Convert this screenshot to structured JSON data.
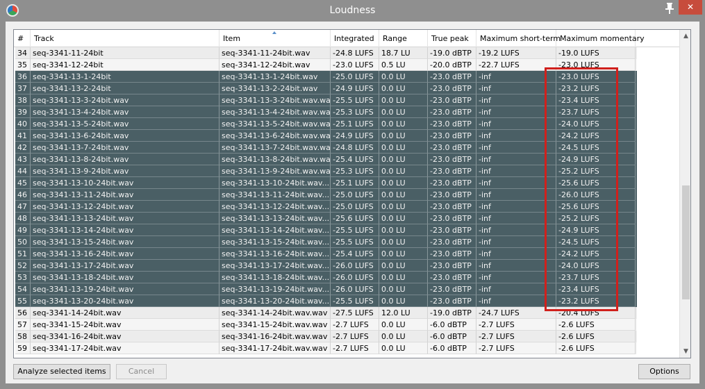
{
  "window": {
    "title": "Loudness",
    "close_label": "✕"
  },
  "table": {
    "columns": [
      "#",
      "Track",
      "Item",
      "Integrated",
      "Range",
      "True peak",
      "Maximum short-term",
      "Maximum momentary"
    ],
    "sort_column": "Item",
    "rows": [
      {
        "num": "34",
        "track": "seq-3341-11-24bit",
        "item": "seq-3341-11-24bit.wav",
        "integrated": "-24.8 LUFS",
        "range": "18.7 LU",
        "truepeak": "-19.0 dBTP",
        "shortterm": "-19.2 LUFS",
        "momentary": "-19.0 LUFS",
        "selected": false
      },
      {
        "num": "35",
        "track": "seq-3341-12-24bit",
        "item": "seq-3341-12-24bit.wav",
        "integrated": "-23.0 LUFS",
        "range": "0.5 LU",
        "truepeak": "-20.0 dBTP",
        "shortterm": "-22.7 LUFS",
        "momentary": "-23.0 LUFS",
        "selected": false
      },
      {
        "num": "36",
        "track": "seq-3341-13-1-24bit",
        "item": "seq-3341-13-1-24bit.wav",
        "integrated": "-25.0 LUFS",
        "range": "0.0 LU",
        "truepeak": "-23.0 dBTP",
        "shortterm": "-inf",
        "momentary": "-23.0 LUFS",
        "selected": true
      },
      {
        "num": "37",
        "track": "seq-3341-13-2-24bit",
        "item": "seq-3341-13-2-24bit.wav",
        "integrated": "-24.9 LUFS",
        "range": "0.0 LU",
        "truepeak": "-23.0 dBTP",
        "shortterm": "-inf",
        "momentary": "-23.2 LUFS",
        "selected": true
      },
      {
        "num": "38",
        "track": "seq-3341-13-3-24bit.wav",
        "item": "seq-3341-13-3-24bit.wav.wav",
        "integrated": "-25.5 LUFS",
        "range": "0.0 LU",
        "truepeak": "-23.0 dBTP",
        "shortterm": "-inf",
        "momentary": "-23.4 LUFS",
        "selected": true
      },
      {
        "num": "39",
        "track": "seq-3341-13-4-24bit.wav",
        "item": "seq-3341-13-4-24bit.wav.wav",
        "integrated": "-25.3 LUFS",
        "range": "0.0 LU",
        "truepeak": "-23.0 dBTP",
        "shortterm": "-inf",
        "momentary": "-23.7 LUFS",
        "selected": true
      },
      {
        "num": "40",
        "track": "seq-3341-13-5-24bit.wav",
        "item": "seq-3341-13-5-24bit.wav.wav",
        "integrated": "-25.1 LUFS",
        "range": "0.0 LU",
        "truepeak": "-23.0 dBTP",
        "shortterm": "-inf",
        "momentary": "-24.0 LUFS",
        "selected": true
      },
      {
        "num": "41",
        "track": "seq-3341-13-6-24bit.wav",
        "item": "seq-3341-13-6-24bit.wav.wav",
        "integrated": "-24.9 LUFS",
        "range": "0.0 LU",
        "truepeak": "-23.0 dBTP",
        "shortterm": "-inf",
        "momentary": "-24.2 LUFS",
        "selected": true
      },
      {
        "num": "42",
        "track": "seq-3341-13-7-24bit.wav",
        "item": "seq-3341-13-7-24bit.wav.wav",
        "integrated": "-24.8 LUFS",
        "range": "0.0 LU",
        "truepeak": "-23.0 dBTP",
        "shortterm": "-inf",
        "momentary": "-24.5 LUFS",
        "selected": true
      },
      {
        "num": "43",
        "track": "seq-3341-13-8-24bit.wav",
        "item": "seq-3341-13-8-24bit.wav.wav",
        "integrated": "-25.4 LUFS",
        "range": "0.0 LU",
        "truepeak": "-23.0 dBTP",
        "shortterm": "-inf",
        "momentary": "-24.9 LUFS",
        "selected": true
      },
      {
        "num": "44",
        "track": "seq-3341-13-9-24bit.wav",
        "item": "seq-3341-13-9-24bit.wav.wav",
        "integrated": "-25.3 LUFS",
        "range": "0.0 LU",
        "truepeak": "-23.0 dBTP",
        "shortterm": "-inf",
        "momentary": "-25.2 LUFS",
        "selected": true
      },
      {
        "num": "45",
        "track": "seq-3341-13-10-24bit.wav",
        "item": "seq-3341-13-10-24bit.wav....",
        "integrated": "-25.1 LUFS",
        "range": "0.0 LU",
        "truepeak": "-23.0 dBTP",
        "shortterm": "-inf",
        "momentary": "-25.6 LUFS",
        "selected": true
      },
      {
        "num": "46",
        "track": "seq-3341-13-11-24bit.wav",
        "item": "seq-3341-13-11-24bit.wav....",
        "integrated": "-25.0 LUFS",
        "range": "0.0 LU",
        "truepeak": "-23.0 dBTP",
        "shortterm": "-inf",
        "momentary": "-26.0 LUFS",
        "selected": true
      },
      {
        "num": "47",
        "track": "seq-3341-13-12-24bit.wav",
        "item": "seq-3341-13-12-24bit.wav....",
        "integrated": "-25.0 LUFS",
        "range": "0.0 LU",
        "truepeak": "-23.0 dBTP",
        "shortterm": "-inf",
        "momentary": "-25.6 LUFS",
        "selected": true
      },
      {
        "num": "48",
        "track": "seq-3341-13-13-24bit.wav",
        "item": "seq-3341-13-13-24bit.wav....",
        "integrated": "-25.6 LUFS",
        "range": "0.0 LU",
        "truepeak": "-23.0 dBTP",
        "shortterm": "-inf",
        "momentary": "-25.2 LUFS",
        "selected": true
      },
      {
        "num": "49",
        "track": "seq-3341-13-14-24bit.wav",
        "item": "seq-3341-13-14-24bit.wav....",
        "integrated": "-25.5 LUFS",
        "range": "0.0 LU",
        "truepeak": "-23.0 dBTP",
        "shortterm": "-inf",
        "momentary": "-24.9 LUFS",
        "selected": true
      },
      {
        "num": "50",
        "track": "seq-3341-13-15-24bit.wav",
        "item": "seq-3341-13-15-24bit.wav....",
        "integrated": "-25.5 LUFS",
        "range": "0.0 LU",
        "truepeak": "-23.0 dBTP",
        "shortterm": "-inf",
        "momentary": "-24.5 LUFS",
        "selected": true
      },
      {
        "num": "51",
        "track": "seq-3341-13-16-24bit.wav",
        "item": "seq-3341-13-16-24bit.wav....",
        "integrated": "-25.4 LUFS",
        "range": "0.0 LU",
        "truepeak": "-23.0 dBTP",
        "shortterm": "-inf",
        "momentary": "-24.2 LUFS",
        "selected": true
      },
      {
        "num": "52",
        "track": "seq-3341-13-17-24bit.wav",
        "item": "seq-3341-13-17-24bit.wav....",
        "integrated": "-26.0 LUFS",
        "range": "0.0 LU",
        "truepeak": "-23.0 dBTP",
        "shortterm": "-inf",
        "momentary": "-24.0 LUFS",
        "selected": true
      },
      {
        "num": "53",
        "track": "seq-3341-13-18-24bit.wav",
        "item": "seq-3341-13-18-24bit.wav....",
        "integrated": "-26.0 LUFS",
        "range": "0.0 LU",
        "truepeak": "-23.0 dBTP",
        "shortterm": "-inf",
        "momentary": "-23.7 LUFS",
        "selected": true
      },
      {
        "num": "54",
        "track": "seq-3341-13-19-24bit.wav",
        "item": "seq-3341-13-19-24bit.wav....",
        "integrated": "-26.0 LUFS",
        "range": "0.0 LU",
        "truepeak": "-23.0 dBTP",
        "shortterm": "-inf",
        "momentary": "-23.4 LUFS",
        "selected": true
      },
      {
        "num": "55",
        "track": "seq-3341-13-20-24bit.wav",
        "item": "seq-3341-13-20-24bit.wav....",
        "integrated": "-25.5 LUFS",
        "range": "0.0 LU",
        "truepeak": "-23.0 dBTP",
        "shortterm": "-inf",
        "momentary": "-23.2 LUFS",
        "selected": true
      },
      {
        "num": "56",
        "track": "seq-3341-14-24bit.wav",
        "item": "seq-3341-14-24bit.wav.wav",
        "integrated": "-27.5 LUFS",
        "range": "12.0 LU",
        "truepeak": "-19.0 dBTP",
        "shortterm": "-24.7 LUFS",
        "momentary": "-20.4 LUFS",
        "selected": false
      },
      {
        "num": "57",
        "track": "seq-3341-15-24bit.wav",
        "item": "seq-3341-15-24bit.wav.wav",
        "integrated": "-2.7 LUFS",
        "range": "0.0 LU",
        "truepeak": "-6.0 dBTP",
        "shortterm": "-2.7 LUFS",
        "momentary": "-2.6 LUFS",
        "selected": false
      },
      {
        "num": "58",
        "track": "seq-3341-16-24bit.wav",
        "item": "seq-3341-16-24bit.wav.wav",
        "integrated": "-2.7 LUFS",
        "range": "0.0 LU",
        "truepeak": "-6.0 dBTP",
        "shortterm": "-2.7 LUFS",
        "momentary": "-2.6 LUFS",
        "selected": false
      },
      {
        "num": "59",
        "track": "seq-3341-17-24bit.wav",
        "item": "seq-3341-17-24bit.wav.wav",
        "integrated": "-2.7 LUFS",
        "range": "0.0 LU",
        "truepeak": "-6.0 dBTP",
        "shortterm": "-2.7 LUFS",
        "momentary": "-2.6 LUFS",
        "selected": false
      }
    ]
  },
  "buttons": {
    "analyze": "Analyze selected items",
    "cancel": "Cancel",
    "options": "Options"
  },
  "icons": {
    "app": "reaper-app-icon",
    "pin": "pin-icon",
    "close": "close-icon"
  },
  "colors": {
    "selected_row": "#4a5f65",
    "highlight": "#d0201c",
    "titlebar": "#8f8f8f"
  }
}
